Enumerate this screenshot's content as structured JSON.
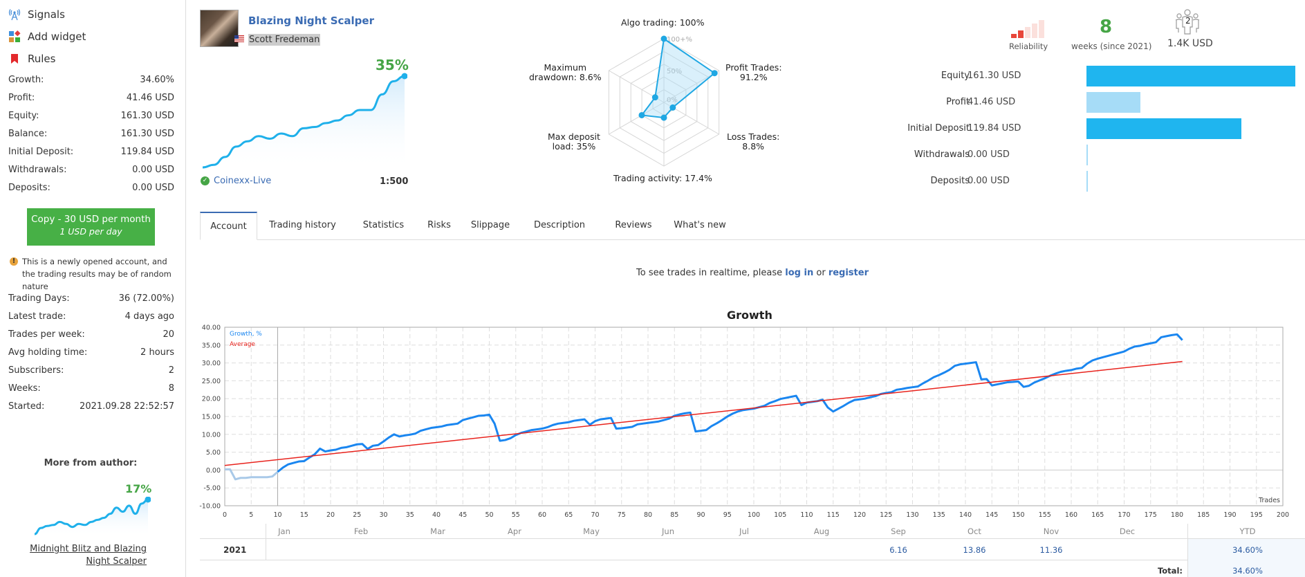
{
  "sidebar": {
    "nav": [
      {
        "label": "Signals",
        "icon": "signal-antenna-icon"
      },
      {
        "label": "Add widget",
        "icon": "widget-icon"
      },
      {
        "label": "Rules",
        "icon": "bookmark-icon"
      }
    ],
    "stats": [
      {
        "label": "Growth:",
        "value": "34.60%"
      },
      {
        "label": "Profit:",
        "value": "41.46 USD"
      },
      {
        "label": "Equity:",
        "value": "161.30 USD"
      },
      {
        "label": "Balance:",
        "value": "161.30 USD"
      },
      {
        "label": "Initial Deposit:",
        "value": "119.84 USD"
      },
      {
        "label": "Withdrawals:",
        "value": "0.00 USD"
      },
      {
        "label": "Deposits:",
        "value": "0.00 USD"
      }
    ],
    "copy_button": {
      "line1": "Copy - 30 USD per month",
      "line2": "1 USD per day",
      "color": "#47b046"
    },
    "warning": "This is a newly opened account, and the trading results may be of random nature",
    "stats2": [
      {
        "label": "Trading Days:",
        "value": "36 (72.00%)"
      },
      {
        "label": "Latest trade:",
        "value": "4 days ago"
      },
      {
        "label": "Trades per week:",
        "value": "20"
      },
      {
        "label": "Avg holding time:",
        "value": "2 hours"
      },
      {
        "label": "Subscribers:",
        "value": "2"
      },
      {
        "label": "Weeks:",
        "value": "8"
      },
      {
        "label": "Started:",
        "value": "2021.09.28 22:52:57"
      }
    ],
    "more_from_author": {
      "title": "More from author:",
      "growth": "17%",
      "link": "Midnight Blitz and Blazing Night Scalper",
      "link_line1": "Midnight Blitz and Blazing",
      "link_line2": "Night Scalper",
      "sparkline": [
        0,
        3,
        4,
        4.5,
        6,
        5,
        3.5,
        5,
        4.5,
        6,
        7,
        8,
        10,
        13,
        11,
        14,
        10,
        15,
        17
      ]
    }
  },
  "header": {
    "signal_title": "Blazing Night Scalper",
    "author": "Scott Fredeman",
    "country_flag": "us-flag",
    "growth": "35%",
    "broker": "Coinexx-Live",
    "leverage": "1:500",
    "sparkline": [
      0,
      1,
      4,
      8,
      10,
      12,
      11,
      13,
      12,
      15,
      15.5,
      17,
      18,
      20,
      22,
      22,
      28,
      33,
      35
    ]
  },
  "radar": {
    "scale_labels": [
      "100+%",
      "50%",
      "0%"
    ],
    "axes": [
      {
        "label_line1": "Algo trading: 100%",
        "label_line2": "",
        "value": 100
      },
      {
        "label_line1": "Profit Trades:",
        "label_line2": "91.2%",
        "value": 91.2
      },
      {
        "label_line1": "Loss Trades:",
        "label_line2": "8.8%",
        "value": 8.8
      },
      {
        "label_line1": "Trading activity: 17.4%",
        "label_line2": "",
        "value": 17.4
      },
      {
        "label_line1": "Max deposit",
        "label_line2": "load: 35%",
        "value": 35
      },
      {
        "label_line1": "Maximum",
        "label_line2": "drawdown: 8.6%",
        "value": 8.6
      }
    ]
  },
  "summary": {
    "reliability_label": "Reliability",
    "reliability_level": 2,
    "reliability_max": 5,
    "weeks": "8",
    "weeks_label": "weeks (since 2021)",
    "subscribers_count": "2",
    "subscribers_funds": "1.4K USD"
  },
  "finance": [
    {
      "label": "Equity",
      "value": "161.30 USD",
      "amount": 161.3,
      "color": "#1fb5ef"
    },
    {
      "label": "Profit",
      "value": "41.46 USD",
      "amount": 41.46,
      "color": "#a6dcf7"
    },
    {
      "label": "Initial Deposit",
      "value": "119.84 USD",
      "amount": 119.84,
      "color": "#1fb5ef"
    },
    {
      "label": "Withdrawals",
      "value": "0.00 USD",
      "amount": 0,
      "color": "#a6dcf7"
    },
    {
      "label": "Deposits",
      "value": "0.00 USD",
      "amount": 0,
      "color": "#a6dcf7"
    }
  ],
  "tabs": [
    {
      "label": "Account",
      "active": true
    },
    {
      "label": "Trading history",
      "active": false
    },
    {
      "label": "Statistics",
      "active": false
    },
    {
      "label": "Risks",
      "active": false
    },
    {
      "label": "Slippage",
      "active": false
    },
    {
      "label": "Description",
      "active": false
    },
    {
      "label": "Reviews",
      "active": false
    },
    {
      "label": "What's new",
      "active": false
    }
  ],
  "realtime": {
    "prefix": "To see trades in realtime, please ",
    "login": "log in",
    "or": " or ",
    "register": "register"
  },
  "chart_data": {
    "type": "line",
    "title": "Growth",
    "xlabel": "Trades",
    "ylabel": "",
    "xlim": [
      0,
      200
    ],
    "ylim": [
      -10,
      40
    ],
    "x_ticks": [
      0,
      5,
      10,
      15,
      20,
      25,
      30,
      35,
      40,
      45,
      50,
      55,
      60,
      65,
      70,
      75,
      80,
      85,
      90,
      95,
      100,
      105,
      110,
      115,
      120,
      125,
      130,
      135,
      140,
      145,
      150,
      155,
      160,
      165,
      170,
      175,
      180,
      185,
      190,
      195,
      200
    ],
    "y_ticks": [
      "40.00",
      "35.00",
      "30.00",
      "25.00",
      "20.00",
      "15.00",
      "10.00",
      "5.00",
      "0.00",
      "-5.00",
      "-10.00"
    ],
    "y_tick_values": [
      40,
      35,
      30,
      25,
      20,
      15,
      10,
      5,
      0,
      -5,
      -10
    ],
    "grid": true,
    "legend": "top-left",
    "start_marker_x": 10,
    "series": [
      {
        "name": "Growth, %",
        "color": "#1a86f0",
        "pre_start_color": "#a9c9e8",
        "points": [
          [
            0,
            0.2
          ],
          [
            1,
            0.2
          ],
          [
            2,
            -2.6
          ],
          [
            3,
            -2.2
          ],
          [
            4,
            -2.2
          ],
          [
            5,
            -2.0
          ],
          [
            6,
            -2.0
          ],
          [
            7,
            -2.0
          ],
          [
            8,
            -2.0
          ],
          [
            9,
            -1.8
          ],
          [
            10,
            -0.5
          ],
          [
            11,
            0.7
          ],
          [
            12,
            1.6
          ],
          [
            13,
            2.0
          ],
          [
            14,
            2.4
          ],
          [
            15,
            2.5
          ],
          [
            16,
            3.5
          ],
          [
            17,
            4.4
          ],
          [
            18,
            6.0
          ],
          [
            19,
            5.2
          ],
          [
            20,
            5.5
          ],
          [
            21,
            5.7
          ],
          [
            22,
            6.2
          ],
          [
            23,
            6.4
          ],
          [
            24,
            6.8
          ],
          [
            25,
            7.2
          ],
          [
            26,
            7.3
          ],
          [
            27,
            5.9
          ],
          [
            28,
            6.8
          ],
          [
            29,
            7.0
          ],
          [
            30,
            8.0
          ],
          [
            31,
            9.1
          ],
          [
            32,
            10.0
          ],
          [
            33,
            9.4
          ],
          [
            34,
            9.7
          ],
          [
            35,
            9.9
          ],
          [
            36,
            10.2
          ],
          [
            37,
            11.0
          ],
          [
            38,
            11.4
          ],
          [
            39,
            11.8
          ],
          [
            40,
            12.0
          ],
          [
            41,
            12.2
          ],
          [
            42,
            12.6
          ],
          [
            43,
            12.8
          ],
          [
            44,
            13.0
          ],
          [
            45,
            14.0
          ],
          [
            46,
            14.4
          ],
          [
            47,
            14.8
          ],
          [
            48,
            15.2
          ],
          [
            49,
            15.3
          ],
          [
            50,
            15.5
          ],
          [
            51,
            13.0
          ],
          [
            52,
            8.2
          ],
          [
            53,
            8.4
          ],
          [
            54,
            8.9
          ],
          [
            55,
            9.8
          ],
          [
            56,
            10.4
          ],
          [
            57,
            10.8
          ],
          [
            58,
            11.2
          ],
          [
            59,
            11.4
          ],
          [
            60,
            11.6
          ],
          [
            61,
            12.0
          ],
          [
            62,
            12.6
          ],
          [
            63,
            13.0
          ],
          [
            64,
            13.2
          ],
          [
            65,
            13.4
          ],
          [
            66,
            13.8
          ],
          [
            67,
            14.0
          ],
          [
            68,
            14.2
          ],
          [
            69,
            12.7
          ],
          [
            70,
            13.7
          ],
          [
            71,
            14.2
          ],
          [
            72,
            14.4
          ],
          [
            73,
            14.6
          ],
          [
            74,
            11.6
          ],
          [
            75,
            11.7
          ],
          [
            76,
            11.9
          ],
          [
            77,
            12.1
          ],
          [
            78,
            12.8
          ],
          [
            79,
            13.0
          ],
          [
            80,
            13.2
          ],
          [
            81,
            13.4
          ],
          [
            82,
            13.6
          ],
          [
            83,
            14.0
          ],
          [
            84,
            14.4
          ],
          [
            85,
            15.2
          ],
          [
            86,
            15.6
          ],
          [
            87,
            15.9
          ],
          [
            88,
            16.1
          ],
          [
            89,
            10.8
          ],
          [
            90,
            11.0
          ],
          [
            91,
            11.2
          ],
          [
            92,
            12.3
          ],
          [
            93,
            13.1
          ],
          [
            94,
            14.0
          ],
          [
            95,
            15.0
          ],
          [
            96,
            15.8
          ],
          [
            97,
            16.4
          ],
          [
            98,
            16.8
          ],
          [
            99,
            17.0
          ],
          [
            100,
            17.2
          ],
          [
            101,
            17.6
          ],
          [
            102,
            18.0
          ],
          [
            103,
            18.8
          ],
          [
            104,
            19.3
          ],
          [
            105,
            19.9
          ],
          [
            106,
            20.2
          ],
          [
            107,
            20.5
          ],
          [
            108,
            20.8
          ],
          [
            109,
            18.2
          ],
          [
            110,
            18.9
          ],
          [
            111,
            19.1
          ],
          [
            112,
            19.3
          ],
          [
            113,
            19.7
          ],
          [
            114,
            17.5
          ],
          [
            115,
            16.4
          ],
          [
            116,
            17.2
          ],
          [
            117,
            18.0
          ],
          [
            118,
            18.9
          ],
          [
            119,
            19.6
          ],
          [
            120,
            19.8
          ],
          [
            121,
            20.0
          ],
          [
            122,
            20.4
          ],
          [
            123,
            20.7
          ],
          [
            124,
            21.3
          ],
          [
            125,
            21.6
          ],
          [
            126,
            21.8
          ],
          [
            127,
            22.5
          ],
          [
            128,
            22.7
          ],
          [
            129,
            23.0
          ],
          [
            130,
            23.2
          ],
          [
            131,
            23.4
          ],
          [
            132,
            24.3
          ],
          [
            133,
            25.1
          ],
          [
            134,
            26.0
          ],
          [
            135,
            26.6
          ],
          [
            136,
            27.3
          ],
          [
            137,
            28.1
          ],
          [
            138,
            29.2
          ],
          [
            139,
            29.6
          ],
          [
            140,
            29.8
          ],
          [
            141,
            30.0
          ],
          [
            142,
            30.2
          ],
          [
            143,
            25.4
          ],
          [
            144,
            25.5
          ],
          [
            145,
            23.7
          ],
          [
            146,
            24.0
          ],
          [
            147,
            24.3
          ],
          [
            148,
            24.6
          ],
          [
            149,
            24.7
          ],
          [
            150,
            24.8
          ],
          [
            151,
            23.3
          ],
          [
            152,
            23.6
          ],
          [
            153,
            24.5
          ],
          [
            154,
            25.1
          ],
          [
            155,
            25.7
          ],
          [
            156,
            26.4
          ],
          [
            157,
            27.0
          ],
          [
            158,
            27.5
          ],
          [
            159,
            27.8
          ],
          [
            160,
            28.0
          ],
          [
            161,
            28.4
          ],
          [
            162,
            28.6
          ],
          [
            163,
            29.8
          ],
          [
            164,
            30.7
          ],
          [
            165,
            31.2
          ],
          [
            166,
            31.6
          ],
          [
            167,
            32.0
          ],
          [
            168,
            32.4
          ],
          [
            169,
            32.8
          ],
          [
            170,
            33.2
          ],
          [
            171,
            34.0
          ],
          [
            172,
            34.6
          ],
          [
            173,
            34.8
          ],
          [
            174,
            35.2
          ],
          [
            175,
            35.5
          ],
          [
            176,
            35.8
          ],
          [
            177,
            37.2
          ],
          [
            178,
            37.5
          ],
          [
            179,
            37.8
          ],
          [
            180,
            38.0
          ],
          [
            181,
            36.4
          ]
        ]
      },
      {
        "name": "Average",
        "color": "#e8221c",
        "points": [
          [
            0,
            1.3
          ],
          [
            181,
            30.4
          ]
        ]
      }
    ]
  },
  "monthly": {
    "months": [
      "Jan",
      "Feb",
      "Mar",
      "Apr",
      "May",
      "Jun",
      "Jul",
      "Aug",
      "Sep",
      "Oct",
      "Nov",
      "Dec"
    ],
    "ytd_label": "YTD",
    "rows": [
      {
        "year": "2021",
        "values": [
          "",
          "",
          "",
          "",
          "",
          "",
          "",
          "",
          "6.16",
          "13.86",
          "11.36",
          ""
        ],
        "ytd": "34.60%"
      }
    ],
    "total_label": "Total:",
    "total": "34.60%"
  }
}
